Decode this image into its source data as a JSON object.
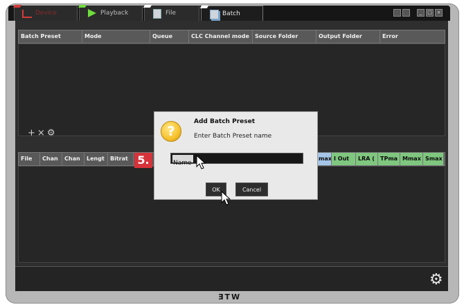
{
  "tabs": [
    {
      "label": "Device",
      "color": "#d43b3b"
    },
    {
      "label": "Playback",
      "color": "#6fdc3d"
    },
    {
      "label": "File",
      "color": "#cfd5db"
    },
    {
      "label": "Batch",
      "color": "#cfd5db"
    }
  ],
  "batch_table": {
    "columns": [
      "Batch Preset",
      "Mode",
      "Queue",
      "CLC Channel mode",
      "Source Folder",
      "Output Folder",
      "Error"
    ]
  },
  "tools": {
    "add": "+",
    "remove": "×",
    "settings": "⚙"
  },
  "file_table": {
    "columns": [
      "File",
      "Chan",
      "Chan",
      "Lengt",
      "Bitrat"
    ],
    "meter_columns": [
      "max",
      "I Out",
      "LRA (",
      "TPma",
      "Mmax",
      "Smax"
    ]
  },
  "step_badge": "5.",
  "dialog": {
    "title": "Add Batch Preset",
    "prompt": "Enter Batch Preset name",
    "input_value": "Name",
    "ok_label": "OK",
    "cancel_label": "Cancel",
    "icon_glyph": "?"
  },
  "brand": "ƎTW"
}
